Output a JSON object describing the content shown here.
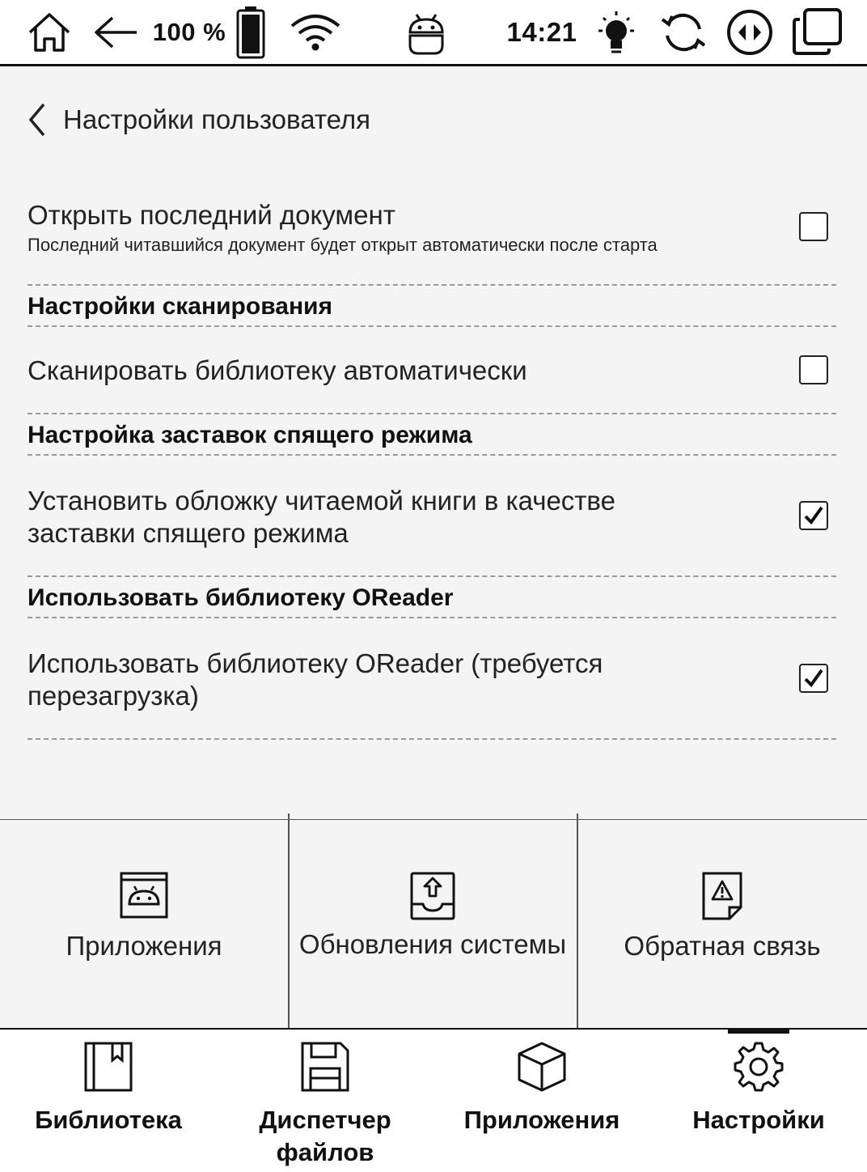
{
  "status_bar": {
    "battery_text": "100 %",
    "time": "14:21",
    "icons": [
      "home-icon",
      "back-arrow-icon",
      "battery-icon",
      "wifi-icon",
      "android-icon",
      "light-bulb-icon",
      "refresh-icon",
      "navigation-icon",
      "multitask-icon"
    ]
  },
  "header": {
    "title": "Настройки пользователя"
  },
  "settings": {
    "open_last": {
      "label": "Открыть последний документ",
      "description": "Последний читавшийся документ будет открыт автоматически после старта",
      "checked": false
    },
    "section_scan": "Настройки сканирования",
    "scan_auto": {
      "label": "Сканировать библиотеку автоматически",
      "checked": false
    },
    "section_screensaver": "Настройка заставок спящего режима",
    "cover_screensaver": {
      "label": "Установить обложку читаемой книги в качестве заставки спящего режима",
      "checked": true
    },
    "section_oreader": "Использовать библиотеку OReader",
    "use_oreader": {
      "label": "Использовать библиотеку OReader (требуется перезагрузка)",
      "checked": true
    }
  },
  "tiles": [
    {
      "label": "Приложения",
      "icon": "android-app-icon"
    },
    {
      "label": "Обновления системы",
      "icon": "system-update-icon"
    },
    {
      "label": "Обратная связь",
      "icon": "feedback-icon"
    }
  ],
  "bottom_nav": [
    {
      "label": "Библиотека",
      "icon": "bookmark-book-icon",
      "active": false
    },
    {
      "label": "Диспетчер файлов",
      "icon": "floppy-disk-icon",
      "active": false
    },
    {
      "label": "Приложения",
      "icon": "cube-icon",
      "active": false
    },
    {
      "label": "Настройки",
      "icon": "gear-icon",
      "active": true
    }
  ]
}
